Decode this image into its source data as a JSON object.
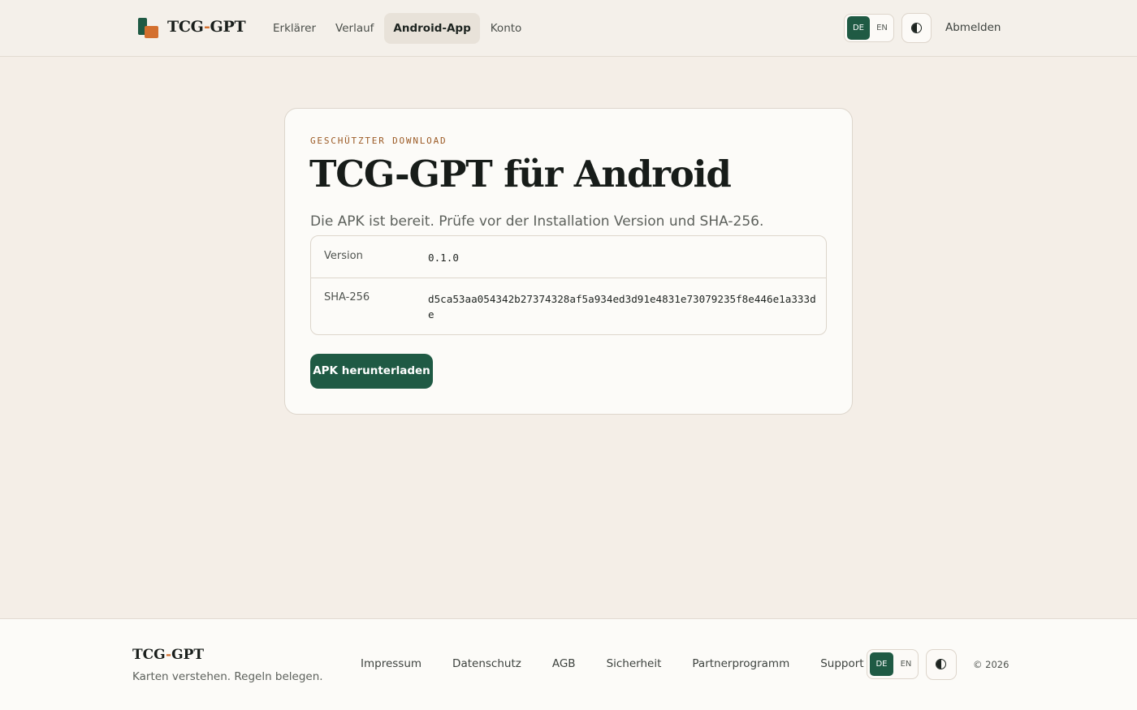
{
  "header": {
    "brand": {
      "pre": "TCG",
      "dash": "-",
      "post": "GPT"
    },
    "nav": [
      {
        "label": "Erklärer",
        "active": false
      },
      {
        "label": "Verlauf",
        "active": false
      },
      {
        "label": "Android-App",
        "active": true
      },
      {
        "label": "Konto",
        "active": false
      }
    ],
    "lang": {
      "de": "DE",
      "en": "EN",
      "selected": "DE"
    },
    "theme_icon": "contrast-icon",
    "logout": "Abmelden"
  },
  "card": {
    "eyebrow": "GESCHÜTZTER DOWNLOAD",
    "title": "TCG-GPT für Android",
    "subtitle": "Die APK ist bereit. Prüfe vor der Installation Version und SHA-256.",
    "meta": [
      {
        "key": "Version",
        "value": "0.1.0"
      },
      {
        "key": "SHA-256",
        "value": "d5ca53aa054342b27374328af5a934ed3d91e4831e73079235f8e446e1a333de"
      }
    ],
    "download_label": "APK herunterladen"
  },
  "footer": {
    "brand": {
      "pre": "TCG",
      "dash": "-",
      "post": "GPT"
    },
    "tagline": "Karten verstehen. Regeln belegen.",
    "links": [
      "Impressum",
      "Datenschutz",
      "AGB",
      "Sicherheit",
      "Partnerprogramm",
      "Support"
    ],
    "lang": {
      "de": "DE",
      "en": "EN",
      "selected": "DE"
    },
    "copyright": "© 2026"
  },
  "colors": {
    "accent": "#1f5a44",
    "brand_orange": "#d36f2e",
    "background": "#f4eee7",
    "eyebrow": "#9b5a25"
  }
}
